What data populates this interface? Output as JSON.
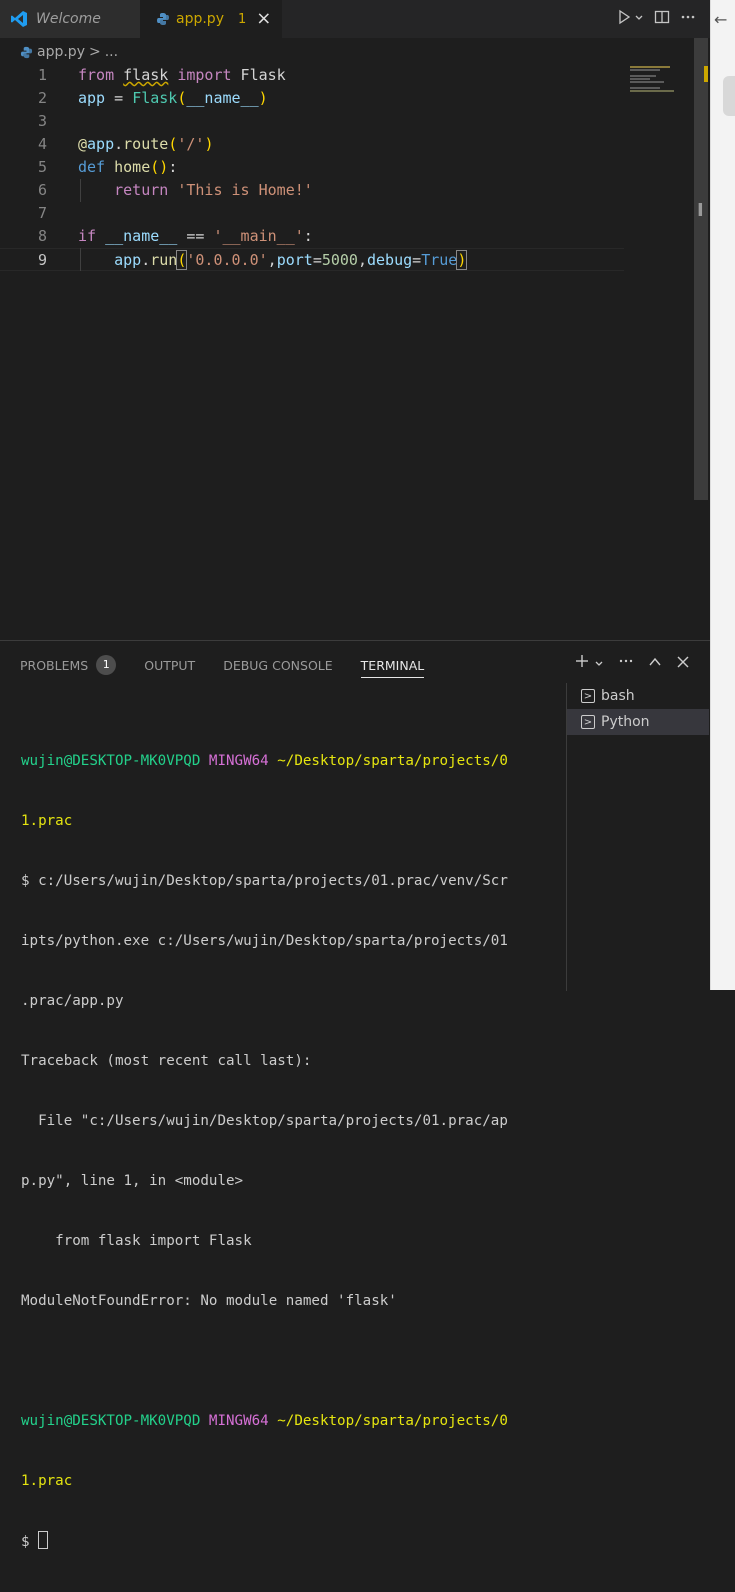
{
  "tabs": {
    "welcome": "Welcome",
    "active_file": "app.py",
    "active_problem_count": "1",
    "close": "×"
  },
  "breadcrumb": {
    "file": "app.py",
    "separator": ">",
    "more": "..."
  },
  "editor": {
    "lines": [
      {
        "n": "1",
        "tokens": [
          [
            "from",
            "kw-purple"
          ],
          [
            " ",
            "plain"
          ],
          [
            "flask",
            "plain squiggle"
          ],
          [
            " ",
            "plain"
          ],
          [
            "import",
            "kw-purple"
          ],
          [
            " Flask",
            "plain"
          ]
        ]
      },
      {
        "n": "2",
        "tokens": [
          [
            "app",
            "var"
          ],
          [
            " = ",
            "plain"
          ],
          [
            "Flask",
            "cls"
          ],
          [
            "(",
            "paren"
          ],
          [
            "__name__",
            "var"
          ],
          [
            ")",
            "paren"
          ]
        ]
      },
      {
        "n": "3",
        "tokens": []
      },
      {
        "n": "4",
        "tokens": [
          [
            "@",
            "fn"
          ],
          [
            "app",
            "var"
          ],
          [
            ".",
            "plain"
          ],
          [
            "route",
            "fn"
          ],
          [
            "(",
            "paren"
          ],
          [
            "'/'",
            "str"
          ],
          [
            ")",
            "paren"
          ]
        ]
      },
      {
        "n": "5",
        "tokens": [
          [
            "def",
            "kw-blue"
          ],
          [
            " ",
            "plain"
          ],
          [
            "home",
            "fn"
          ],
          [
            "()",
            "paren"
          ],
          [
            ":",
            "plain"
          ]
        ]
      },
      {
        "n": "6",
        "tokens": [
          [
            "    ",
            "plain"
          ],
          [
            "return",
            "kw-purple"
          ],
          [
            " ",
            "plain"
          ],
          [
            "'This is Home!'",
            "str"
          ]
        ]
      },
      {
        "n": "7",
        "tokens": []
      },
      {
        "n": "8",
        "tokens": [
          [
            "if",
            "kw-purple"
          ],
          [
            " ",
            "plain"
          ],
          [
            "__name__",
            "var"
          ],
          [
            " == ",
            "plain"
          ],
          [
            "'__main__'",
            "str"
          ],
          [
            ":",
            "plain"
          ]
        ]
      },
      {
        "n": "9",
        "tokens": [
          [
            "    ",
            "plain"
          ],
          [
            "app",
            "var"
          ],
          [
            ".",
            "plain"
          ],
          [
            "run",
            "fn"
          ],
          [
            "(",
            "paren brkbox"
          ],
          [
            "'0.0.0.0'",
            "str"
          ],
          [
            ",",
            "plain"
          ],
          [
            "port",
            "var"
          ],
          [
            "=",
            "plain"
          ],
          [
            "5000",
            "numlit"
          ],
          [
            ",",
            "plain"
          ],
          [
            "debug",
            "var"
          ],
          [
            "=",
            "plain"
          ],
          [
            "True",
            "kw-blue"
          ],
          [
            ")",
            "paren brkbox"
          ]
        ]
      }
    ],
    "active_line": "9"
  },
  "panel": {
    "tabs": [
      {
        "label": "PROBLEMS",
        "badge": "1"
      },
      {
        "label": "OUTPUT"
      },
      {
        "label": "DEBUG CONSOLE"
      },
      {
        "label": "TERMINAL",
        "active": true
      }
    ]
  },
  "terminal": {
    "user": "wujin@DESKTOP-MK0VPQD",
    "host": "MINGW64",
    "path": "~/Desktop/sparta/projects/0",
    "path_cont": "1.prac",
    "output": [
      "$ c:/Users/wujin/Desktop/sparta/projects/01.prac/venv/Scr",
      "ipts/python.exe c:/Users/wujin/Desktop/sparta/projects/01",
      ".prac/app.py",
      "Traceback (most recent call last):",
      "  File \"c:/Users/wujin/Desktop/sparta/projects/01.prac/ap",
      "p.py\", line 1, in <module>",
      "    from flask import Flask",
      "ModuleNotFoundError: No module named 'flask'"
    ],
    "prompt": "$",
    "sessions": [
      "bash",
      "Python"
    ],
    "active_session": "Python"
  },
  "colors": {
    "accent_warning": "#cca700",
    "terminal_user": "#23d18b",
    "terminal_host": "#d670d6",
    "terminal_path": "#e5e510"
  }
}
